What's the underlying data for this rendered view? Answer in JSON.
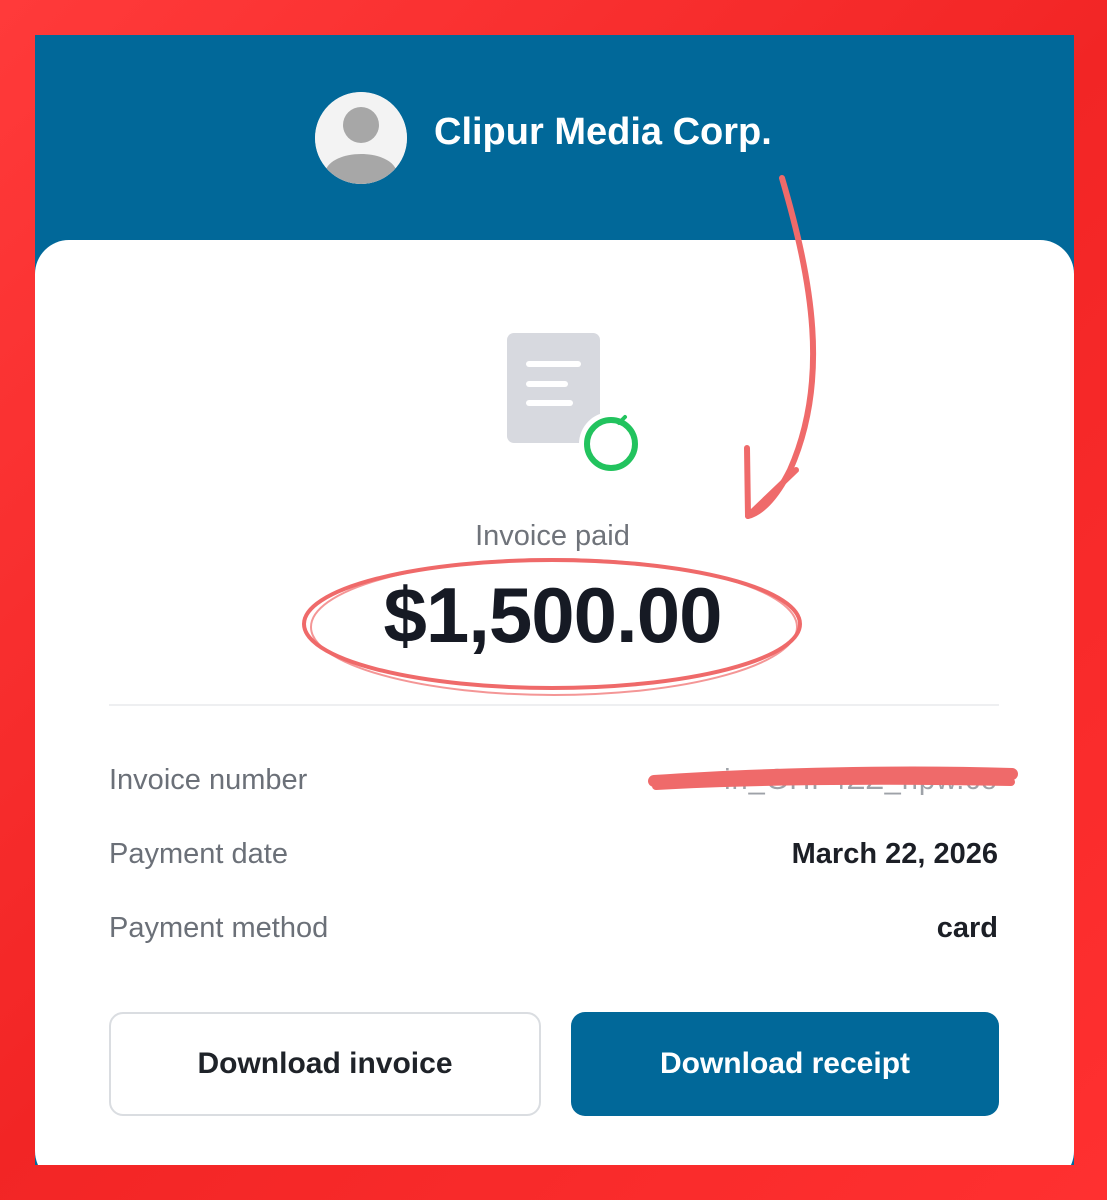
{
  "header": {
    "company_name": "Clipur Media Corp.",
    "avatar_icon": "user-avatar-icon"
  },
  "invoice": {
    "status_label": "Invoice paid",
    "amount": "$1,500.00",
    "icon": "document-check-icon"
  },
  "details": [
    {
      "label": "Invoice number",
      "value": "in_GHF4ZZ_npw.co"
    },
    {
      "label": "Payment date",
      "value": "March 22, 2026"
    },
    {
      "label": "Payment method",
      "value": "card"
    }
  ],
  "actions": {
    "download_invoice_label": "Download invoice",
    "download_receipt_label": "Download receipt"
  },
  "colors": {
    "border_red": "#ff2e2e",
    "brand_blue": "#016899",
    "annotation_red": "#ef6a6a",
    "success_green": "#22c35e"
  }
}
